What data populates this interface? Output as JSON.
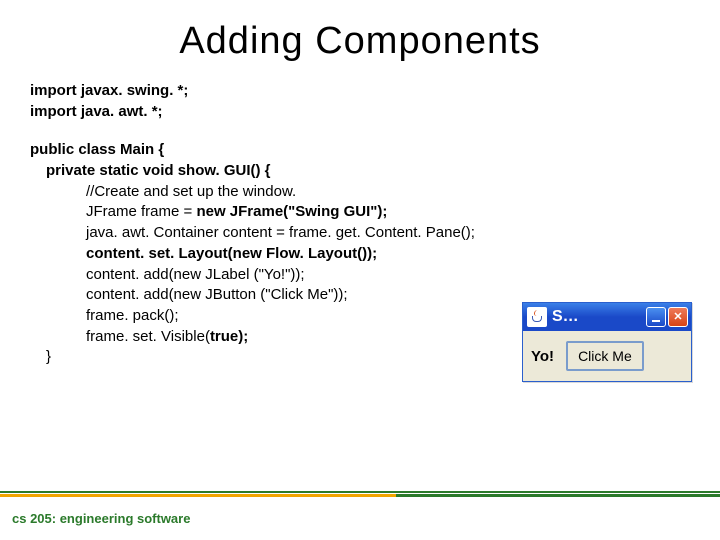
{
  "title": "Adding Components",
  "code": {
    "import1": "import javax. swing. *;",
    "import2": "import java. awt. *;",
    "classDecl": "public class Main {",
    "methodDecl": "private static void show. GUI() {",
    "comment": "//Create and set up the window.",
    "line_jframe_a": "JFrame frame = ",
    "line_jframe_b": "new JFrame(\"Swing GUI\");",
    "line_container": "java. awt. Container content = frame. get. Content. Pane();",
    "line_layout": "content. set. Layout(new Flow. Layout());",
    "line_add_label": "content. add(new JLabel (\"Yo!\"));",
    "line_add_button": "content. add(new JButton (\"Click Me\"));",
    "line_pack": "frame. pack();",
    "line_visible_a": "frame. set. Visible(",
    "line_visible_b": "true);",
    "close": "}"
  },
  "window": {
    "title": "S…",
    "label": "Yo!",
    "button": "Click Me"
  },
  "footer": "cs 205: engineering software"
}
